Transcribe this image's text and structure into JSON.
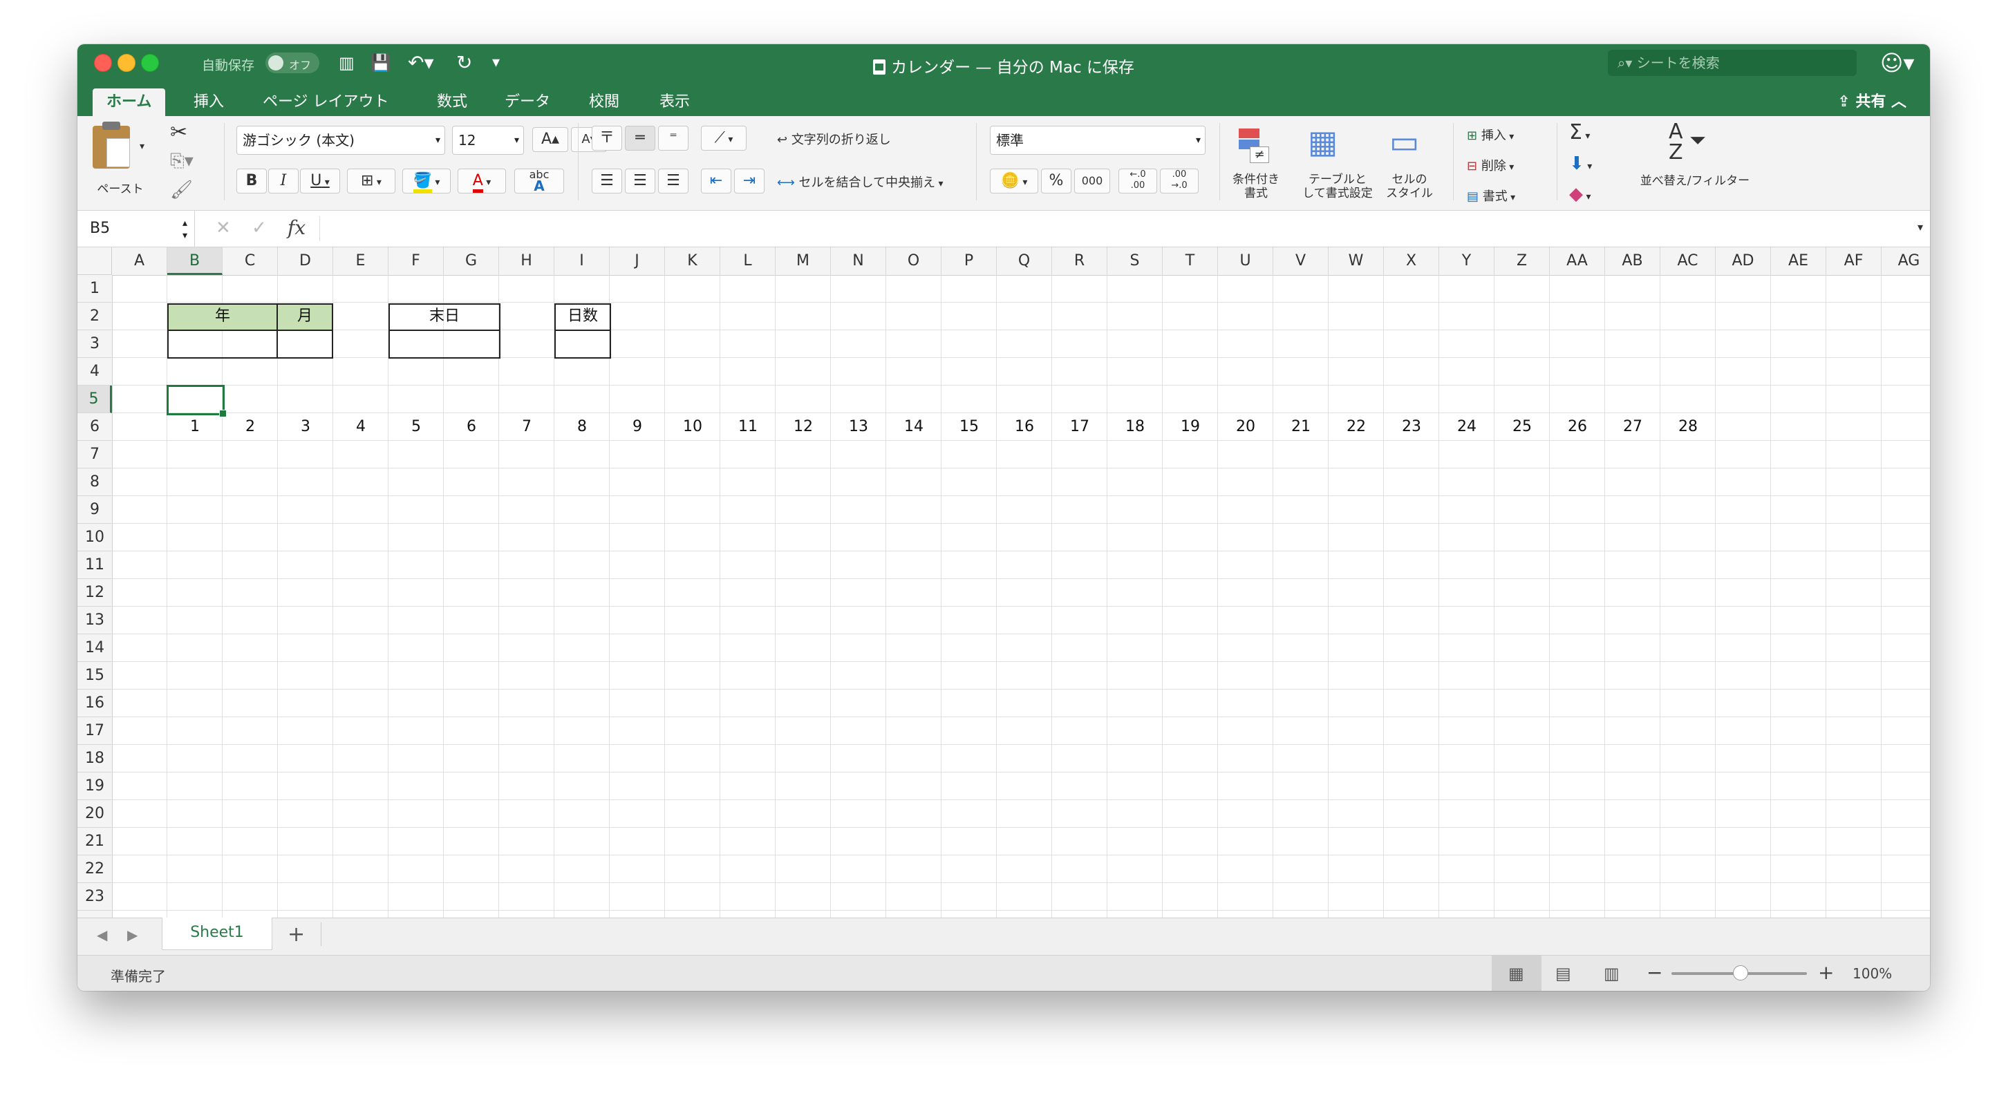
{
  "window": {
    "title": "カレンダー — 自分の Mac に保存",
    "autosave_label": "自動保存",
    "autosave_state": "オフ",
    "search_placeholder": "シートを検索"
  },
  "tabs": [
    "ホーム",
    "挿入",
    "ページ レイアウト",
    "数式",
    "データ",
    "校閲",
    "表示"
  ],
  "share_label": "共有",
  "ribbon": {
    "paste": "ペースト",
    "font_name": "游ゴシック (本文)",
    "font_size": "12",
    "bold": "B",
    "italic": "I",
    "underline": "U",
    "wrap_text": "文字列の折り返し",
    "merge_center": "セルを結合して中央揃え",
    "number_format": "標準",
    "percent": "%",
    "thousands": "000",
    "conditional_format": [
      "条件付き",
      "書式"
    ],
    "format_as_table": [
      "テーブルと",
      "して書式設定"
    ],
    "cell_styles": [
      "セルの",
      "スタイル"
    ],
    "insert": "挿入",
    "delete": "削除",
    "format": "書式",
    "sort_filter": "並べ替え/フィルター"
  },
  "formula_bar": {
    "name_box": "B5",
    "fx": "fx"
  },
  "columns": [
    "A",
    "B",
    "C",
    "D",
    "E",
    "F",
    "G",
    "H",
    "I",
    "J",
    "K",
    "L",
    "M",
    "N",
    "O",
    "P",
    "Q",
    "R",
    "S",
    "T",
    "U",
    "V",
    "W",
    "X",
    "Y",
    "Z",
    "AA",
    "AB",
    "AC",
    "AD",
    "AE",
    "AF",
    "AG"
  ],
  "rows": [
    "1",
    "2",
    "3",
    "4",
    "5",
    "6",
    "7",
    "8",
    "9",
    "10",
    "11",
    "12",
    "13",
    "14",
    "15",
    "16",
    "17",
    "18",
    "19",
    "20",
    "21",
    "22",
    "23"
  ],
  "selected_cell": "B5",
  "cells": {
    "year_label": "年",
    "month_label": "月",
    "end_day_label": "末日",
    "day_count_label": "日数",
    "row6_numbers": [
      "1",
      "2",
      "3",
      "4",
      "5",
      "6",
      "7",
      "8",
      "9",
      "10",
      "11",
      "12",
      "13",
      "14",
      "15",
      "16",
      "17",
      "18",
      "19",
      "20",
      "21",
      "22",
      "23",
      "24",
      "25",
      "26",
      "27",
      "28"
    ]
  },
  "header_fill_color": "#c6e0b4",
  "accent_color": "#2a7a49",
  "sheet_tab": "Sheet1",
  "add_sheet": "+",
  "status": "準備完了",
  "zoom_minus": "−",
  "zoom_plus": "+",
  "zoom": "100%"
}
